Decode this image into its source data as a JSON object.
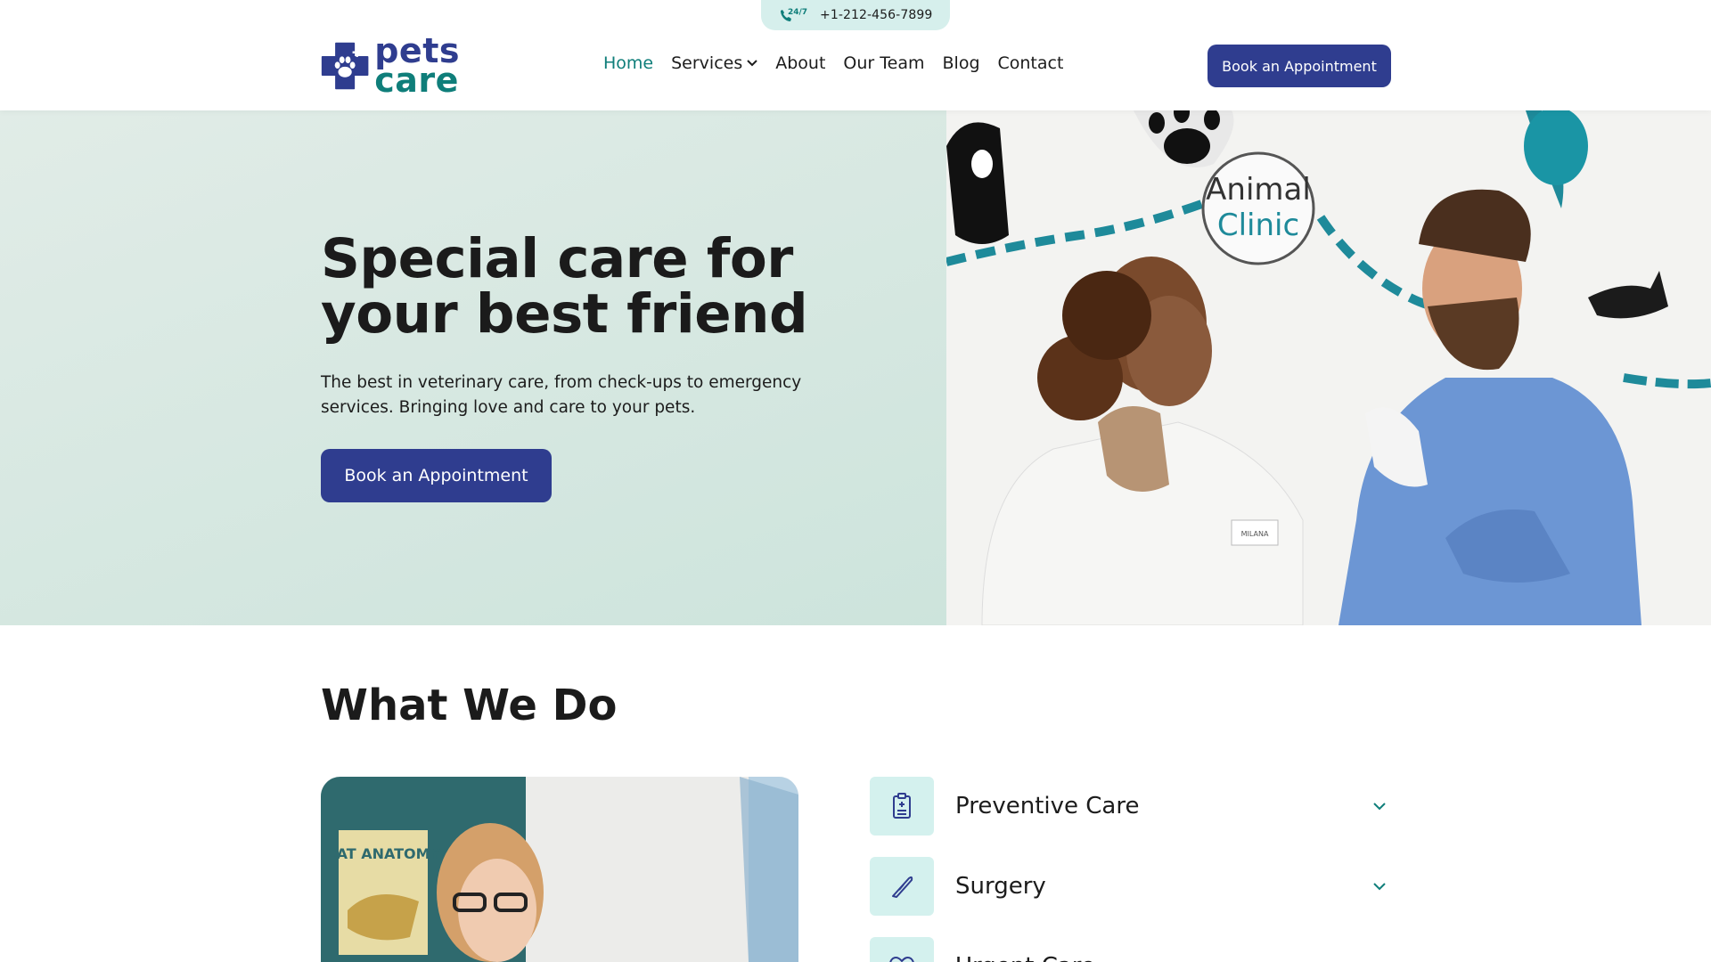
{
  "topbar": {
    "badge": "24/7",
    "phone": "+1-212-456-7899"
  },
  "header": {
    "logo": {
      "line1": "pets",
      "line2": "care"
    },
    "nav": [
      {
        "label": "Home",
        "active": true
      },
      {
        "label": "Services",
        "dropdown": true
      },
      {
        "label": "About"
      },
      {
        "label": "Our Team"
      },
      {
        "label": "Blog"
      },
      {
        "label": "Contact"
      }
    ],
    "cta": "Book an Appointment"
  },
  "hero": {
    "title_line1": "Special care for",
    "title_line2": "your best friend",
    "subtitle": "The best in veterinary care, from check-ups to emergency services. Bringing love and care to your pets.",
    "cta": "Book an Appointment",
    "photo": {
      "sign_line1": "Animal",
      "sign_line2": "Clinic",
      "badge": "MILANA"
    }
  },
  "what_we_do": {
    "title": "What We Do",
    "photo_text": "CAT ANATOMY",
    "services": [
      {
        "label": "Preventive Care",
        "icon": "clipboard-icon"
      },
      {
        "label": "Surgery",
        "icon": "scalpel-icon"
      },
      {
        "label": "Urgent Care",
        "icon": "heart-icon"
      }
    ]
  },
  "colors": {
    "primary": "#2f3d8f",
    "accent": "#0f7e7a",
    "mint": "#d4f1ee",
    "hero_bg": "#d3e6df"
  }
}
